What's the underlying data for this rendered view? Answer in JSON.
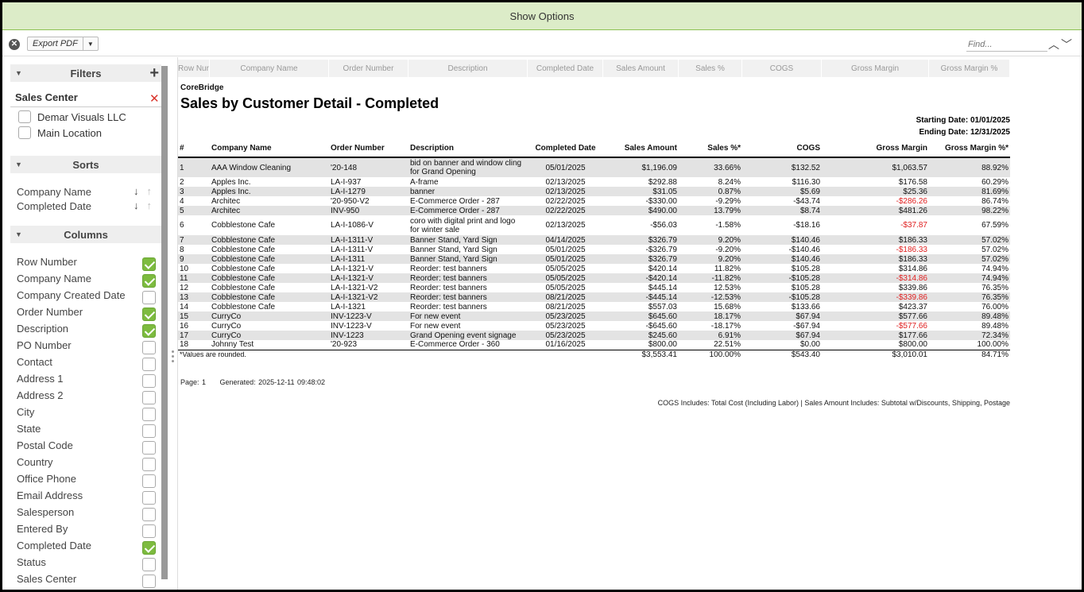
{
  "topbar": {
    "label": "Show Options"
  },
  "toolbar": {
    "export_label": "Export PDF",
    "find_placeholder": "Find..."
  },
  "sidebar": {
    "filters_title": "Filters",
    "sales_center_label": "Sales Center",
    "locations": [
      "Demar Visuals LLC",
      "Main Location"
    ],
    "sorts_title": "Sorts",
    "sorts": [
      "Company Name",
      "Completed Date"
    ],
    "columns_title": "Columns",
    "columns": [
      {
        "label": "Row Number",
        "checked": true
      },
      {
        "label": "Company Name",
        "checked": true
      },
      {
        "label": "Company Created Date",
        "checked": false
      },
      {
        "label": "Order Number",
        "checked": true
      },
      {
        "label": "Description",
        "checked": true
      },
      {
        "label": "PO Number",
        "checked": false
      },
      {
        "label": "Contact",
        "checked": false
      },
      {
        "label": "Address 1",
        "checked": false
      },
      {
        "label": "Address 2",
        "checked": false
      },
      {
        "label": "City",
        "checked": false
      },
      {
        "label": "State",
        "checked": false
      },
      {
        "label": "Postal Code",
        "checked": false
      },
      {
        "label": "Country",
        "checked": false
      },
      {
        "label": "Office Phone",
        "checked": false
      },
      {
        "label": "Email Address",
        "checked": false
      },
      {
        "label": "Salesperson",
        "checked": false
      },
      {
        "label": "Entered By",
        "checked": false
      },
      {
        "label": "Completed Date",
        "checked": true
      },
      {
        "label": "Status",
        "checked": false
      },
      {
        "label": "Sales Center",
        "checked": false
      }
    ]
  },
  "column_headers": [
    "Row Nur",
    "Company Name",
    "Order Number",
    "Description",
    "Completed Date",
    "Sales Amount",
    "Sales %",
    "COGS",
    "Gross Margin",
    "Gross Margin %"
  ],
  "report": {
    "company": "CoreBridge",
    "title": "Sales by Customer Detail - Completed",
    "starting_date": "Starting Date: 01/01/2025",
    "ending_date": "Ending Date: 12/31/2025",
    "headers": [
      "#",
      "Company Name",
      "Order Number",
      "Description",
      "Completed Date",
      "Sales Amount",
      "Sales %*",
      "COGS",
      "Gross Margin",
      "Gross Margin %*"
    ],
    "rows": [
      [
        "1",
        "AAA Window Cleaning",
        "'20-148",
        "bid on banner and window cling for Grand Opening",
        "05/01/2025",
        "$1,196.09",
        "33.66%",
        "$132.52",
        "$1,063.57",
        "88.92%"
      ],
      [
        "2",
        "Apples Inc.",
        "LA-I-937",
        "A-frame",
        "02/13/2025",
        "$292.88",
        "8.24%",
        "$116.30",
        "$176.58",
        "60.29%"
      ],
      [
        "3",
        "Apples Inc.",
        "LA-I-1279",
        "banner",
        "02/13/2025",
        "$31.05",
        "0.87%",
        "$5.69",
        "$25.36",
        "81.69%"
      ],
      [
        "4",
        "Architec",
        "'20-950-V2",
        "E-Commerce Order - 287",
        "02/22/2025",
        "-$330.00",
        "-9.29%",
        "-$43.74",
        "-$286.26",
        "86.74%"
      ],
      [
        "5",
        "Architec",
        "INV-950",
        "E-Commerce Order - 287",
        "02/22/2025",
        "$490.00",
        "13.79%",
        "$8.74",
        "$481.26",
        "98.22%"
      ],
      [
        "6",
        "Cobblestone Cafe",
        "LA-I-1086-V",
        "coro with digital print and logo for winter sale",
        "02/13/2025",
        "-$56.03",
        "-1.58%",
        "-$18.16",
        "-$37.87",
        "67.59%"
      ],
      [
        "7",
        "Cobblestone Cafe",
        "LA-I-1311-V",
        "Banner Stand, Yard Sign",
        "04/14/2025",
        "$326.79",
        "9.20%",
        "$140.46",
        "$186.33",
        "57.02%"
      ],
      [
        "8",
        "Cobblestone Cafe",
        "LA-I-1311-V",
        "Banner Stand, Yard Sign",
        "05/01/2025",
        "-$326.79",
        "-9.20%",
        "-$140.46",
        "-$186.33",
        "57.02%"
      ],
      [
        "9",
        "Cobblestone Cafe",
        "LA-I-1311",
        "Banner Stand, Yard Sign",
        "05/01/2025",
        "$326.79",
        "9.20%",
        "$140.46",
        "$186.33",
        "57.02%"
      ],
      [
        "10",
        "Cobblestone Cafe",
        "LA-I-1321-V",
        "Reorder: test banners",
        "05/05/2025",
        "$420.14",
        "11.82%",
        "$105.28",
        "$314.86",
        "74.94%"
      ],
      [
        "11",
        "Cobblestone Cafe",
        "LA-I-1321-V",
        "Reorder: test banners",
        "05/05/2025",
        "-$420.14",
        "-11.82%",
        "-$105.28",
        "-$314.86",
        "74.94%"
      ],
      [
        "12",
        "Cobblestone Cafe",
        "LA-I-1321-V2",
        "Reorder: test banners",
        "05/05/2025",
        "$445.14",
        "12.53%",
        "$105.28",
        "$339.86",
        "76.35%"
      ],
      [
        "13",
        "Cobblestone Cafe",
        "LA-I-1321-V2",
        "Reorder: test banners",
        "08/21/2025",
        "-$445.14",
        "-12.53%",
        "-$105.28",
        "-$339.86",
        "76.35%"
      ],
      [
        "14",
        "Cobblestone Cafe",
        "LA-I-1321",
        "Reorder: test banners",
        "08/21/2025",
        "$557.03",
        "15.68%",
        "$133.66",
        "$423.37",
        "76.00%"
      ],
      [
        "15",
        "CurryCo",
        "INV-1223-V",
        "For new event",
        "05/23/2025",
        "$645.60",
        "18.17%",
        "$67.94",
        "$577.66",
        "89.48%"
      ],
      [
        "16",
        "CurryCo",
        "INV-1223-V",
        "For new event",
        "05/23/2025",
        "-$645.60",
        "-18.17%",
        "-$67.94",
        "-$577.66",
        "89.48%"
      ],
      [
        "17",
        "CurryCo",
        "INV-1223",
        "Grand Opening event signage",
        "05/23/2025",
        "$245.60",
        "6.91%",
        "$67.94",
        "$177.66",
        "72.34%"
      ],
      [
        "18",
        "Johnny Test",
        "'20-923",
        "E-Commerce Order - 360",
        "01/16/2025",
        "$800.00",
        "22.51%",
        "$0.00",
        "$800.00",
        "100.00%"
      ]
    ],
    "totals_note": "*Values are rounded.",
    "totals": [
      "$3,553.41",
      "100.00%",
      "$543.40",
      "$3,010.01",
      "84.71%"
    ],
    "page_text": "Page: 1",
    "generated_text": "Generated: 2025-12-11 09:48:02",
    "footer_note": "COGS Includes: Total Cost (Including Labor) | Sales Amount Includes: Subtotal w/Discounts, Shipping, Postage"
  },
  "colors": {
    "accent_green": "#7dbb3f",
    "topbar_bg": "#dcecc8",
    "negative_red": "#e02020"
  }
}
